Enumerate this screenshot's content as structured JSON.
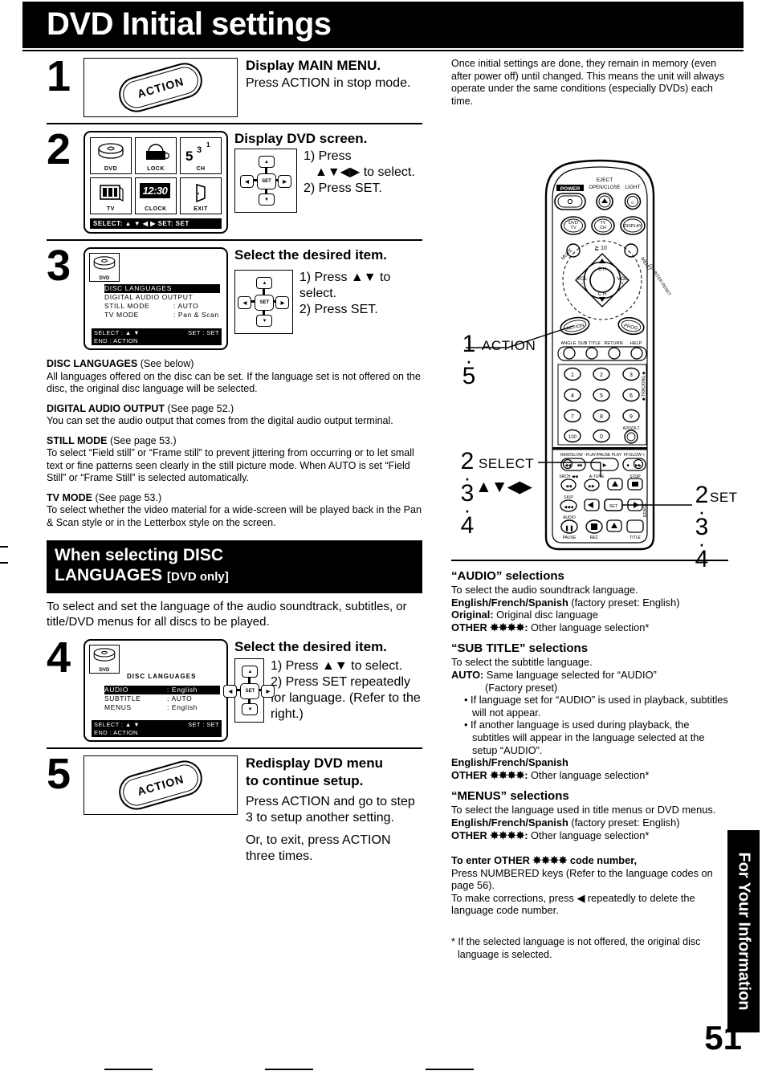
{
  "header": {
    "title": "DVD Initial settings"
  },
  "page_number": "51",
  "side_tab": {
    "label": "For Your Information"
  },
  "intro": "Once initial settings are done, they remain in memory (even after power off) until changed. This means the unit will always operate under the same conditions (especially DVDs) each time.",
  "steps": [
    {
      "num": "1",
      "illustration": "action-button",
      "button_label": "ACTION",
      "heading": "Display MAIN MENU.",
      "body": "Press ACTION in stop mode."
    },
    {
      "num": "2",
      "illustration": "main-menu-screen",
      "heading": "Display DVD screen.",
      "items": [
        "1) Press",
        "2) Press SET."
      ],
      "arrow_note": "▲▼◀▶ to select.",
      "screen": {
        "cells": [
          {
            "icon": "disc-icon",
            "caption": "DVD"
          },
          {
            "icon": "lock-icon",
            "caption": "LOCK"
          },
          {
            "icon": "channel-icon",
            "caption": "CH",
            "big": "5",
            "sup1": "3",
            "sup2": "1"
          },
          {
            "icon": "tv-icon",
            "caption": "TV"
          },
          {
            "icon": "clock-icon",
            "caption": "CLOCK",
            "clock_value": "12:30"
          },
          {
            "icon": "exit-icon",
            "caption": "EXIT"
          }
        ],
        "status_bar": "SELECT: ▲ ▼ ◀ ▶   SET:  SET"
      }
    },
    {
      "num": "3",
      "illustration": "dvd-setup-screen",
      "heading": "Select the desired item.",
      "items": [
        "1) Press ▲▼ to select.",
        "2) Press SET."
      ],
      "screen": {
        "disc_caption": "DVD",
        "rows": [
          {
            "key": "DISC LANGUAGES",
            "value": "",
            "selected": true
          },
          {
            "key": "DIGITAL AUDIO  OUTPUT",
            "value": "",
            "selected": false
          },
          {
            "key": "STILL  MODE",
            "value": ": AUTO",
            "selected": false
          },
          {
            "key": "TV  MODE",
            "value": ": Pan & Scan",
            "selected": false
          }
        ],
        "foot_left_1": "SELECT :  ▲  ▼",
        "foot_right_1": "SET : SET",
        "foot_left_2": "END     :  ACTION"
      }
    },
    {
      "num": "4",
      "illustration": "disc-languages-screen",
      "heading": "Select the desired item.",
      "items": [
        "1) Press ▲▼ to select.",
        "2) Press SET repeatedly for language. (Refer to the right.)"
      ],
      "screen": {
        "disc_caption": "DVD",
        "title": "DISC   LANGUAGES",
        "rows": [
          {
            "key": "AUDIO",
            "value": ": English",
            "selected": true
          },
          {
            "key": "SUBTITLE",
            "value": ": AUTO",
            "selected": false
          },
          {
            "key": "MENUS",
            "value": ": English",
            "selected": false
          }
        ],
        "foot_left_1": "SELECT :  ▲  ▼",
        "foot_right_1": "SET : SET",
        "foot_left_2": "END     :  ACTION"
      }
    },
    {
      "num": "5",
      "illustration": "action-button",
      "button_label": "ACTION",
      "heading_line1": "Redisplay DVD menu",
      "heading_line2": "to continue setup.",
      "body1": "Press ACTION and go to step 3 to setup another setting.",
      "body2": "Or, to exit, press ACTION three times."
    }
  ],
  "descriptions": [
    {
      "term": "DISC LANGUAGES",
      "ref": "(See below)",
      "text": "All languages offered on the disc can be set. If the language set is not offered on the disc, the original disc language will be selected."
    },
    {
      "term": "DIGITAL AUDIO OUTPUT",
      "ref": "(See page 52.)",
      "text": "You can set the audio output that comes from the digital audio output terminal."
    },
    {
      "term": "STILL MODE",
      "ref": "(See page 53.)",
      "text": "To select “Field still” or “Frame still” to prevent jittering from occurring or to let small text or fine patterns seen clearly in the still picture mode. When AUTO is set “Field Still” or “Frame Still” is selected automatically."
    },
    {
      "term": "TV MODE",
      "ref": "(See page 53.)",
      "text": "To select whether the video material for a wide-screen will be played back in the Pan & Scan style or in the Letterbox style on the screen."
    }
  ],
  "banner": {
    "line1": "When selecting DISC",
    "line2": "LANGUAGES",
    "line2_suffix": "[DVD only]",
    "note": "To select and set the language of the audio soundtrack, subtitles, or title/DVD menus for all discs to be played."
  },
  "remote": {
    "top_labels": {
      "power": "POWER",
      "eject": "EJECT",
      "open_close": "OPEN/CLOSE",
      "light": "LIGHT"
    },
    "mode_buttons": [
      "DVD/TV",
      "TV/CH",
      "DISPLAY"
    ],
    "ring_labels": {
      "mute": "MUTE",
      "ge10": "≧ 10",
      "menu": "MENU",
      "counter_reset": "COUNTER RESET",
      "ch_up": "C H",
      "ch_dn": "C H",
      "vol_minus": "VOL",
      "vol_plus": "VOL"
    },
    "mid_buttons": [
      "ACTION",
      "PROG"
    ],
    "function_row": [
      "ANGLE",
      "SUB TITLE",
      "RETURN",
      "HELP"
    ],
    "keypad": [
      "1",
      "2",
      "3",
      "4",
      "5",
      "6",
      "7",
      "8",
      "9",
      "100",
      "0",
      "ADD/DLT"
    ],
    "transport_labels": [
      "REW/SLOW −",
      "PLAY/PAUSE PLAY",
      "FF/SLOW +",
      "SRCH ◀◀",
      "A-TUNE",
      "STOP",
      "SKIP",
      "AUDIO",
      "PAUSE",
      "REC",
      "TITLE",
      "SET"
    ],
    "callouts": [
      {
        "nums": [
          "1",
          "5"
        ],
        "label": "ACTION",
        "side": "left"
      },
      {
        "nums": [
          "2",
          "3",
          "4"
        ],
        "label": "SELECT",
        "sub": "▲▼◀▶",
        "side": "left"
      },
      {
        "nums": [
          "2",
          "3",
          "4"
        ],
        "label": "SET",
        "side": "right"
      }
    ]
  },
  "selections": [
    {
      "title": "“AUDIO” selections",
      "intro": "To select the audio soundtrack language.",
      "lines": [
        {
          "b": "English/French/Spanish",
          "t": " (factory preset: English)"
        },
        {
          "b": "Original:",
          "t": " Original disc language"
        },
        {
          "b": "OTHER ✸✸✸✸:",
          "t": " Other language selection*"
        }
      ]
    },
    {
      "title": "“SUB TITLE” selections",
      "intro": "To select the subtitle language.",
      "auto_label": "AUTO:",
      "auto_text": " Same language selected for “AUDIO”",
      "auto_text2": "(Factory preset)",
      "bullets": [
        "• If language set for “AUDIO” is used in playback, subtitles will not appear.",
        "• If another language is used during playback, the subtitles will appear in the language selected at the setup “AUDIO”."
      ],
      "lines": [
        {
          "b": "English/French/Spanish",
          "t": ""
        },
        {
          "b": "OTHER ✸✸✸✸:",
          "t": " Other language selection*"
        }
      ]
    },
    {
      "title": "“MENUS” selections",
      "intro": "To select the language used in title menus or DVD menus.",
      "lines": [
        {
          "b": "English/French/Spanish",
          "t": " (factory preset: English)"
        },
        {
          "b": "OTHER ✸✸✸✸:",
          "t": " Other language selection*"
        }
      ]
    }
  ],
  "other_code": {
    "title": "To enter OTHER ✸✸✸✸ code number,",
    "line1": "Press NUMBERED keys (Refer to the language codes on page 56).",
    "line2": "To make corrections, press ◀ repeatedly to delete the language code number."
  },
  "footnote": "* If the selected language is not offered, the original disc language is selected."
}
